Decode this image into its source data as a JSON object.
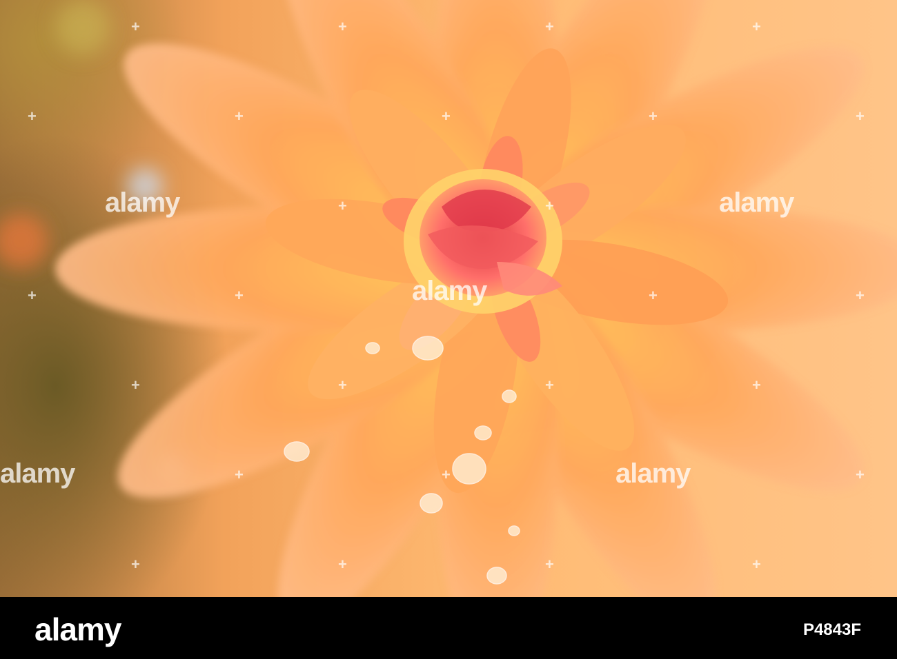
{
  "photo": {
    "subject": "orange-dahlia-with-water-droplets",
    "colors": {
      "petal": "#ffb25a",
      "center": "#e8434b",
      "background": "#6b5a25"
    }
  },
  "watermark": {
    "text": "alamy"
  },
  "footer": {
    "logo": "alamy",
    "image_id": "P4843F"
  }
}
